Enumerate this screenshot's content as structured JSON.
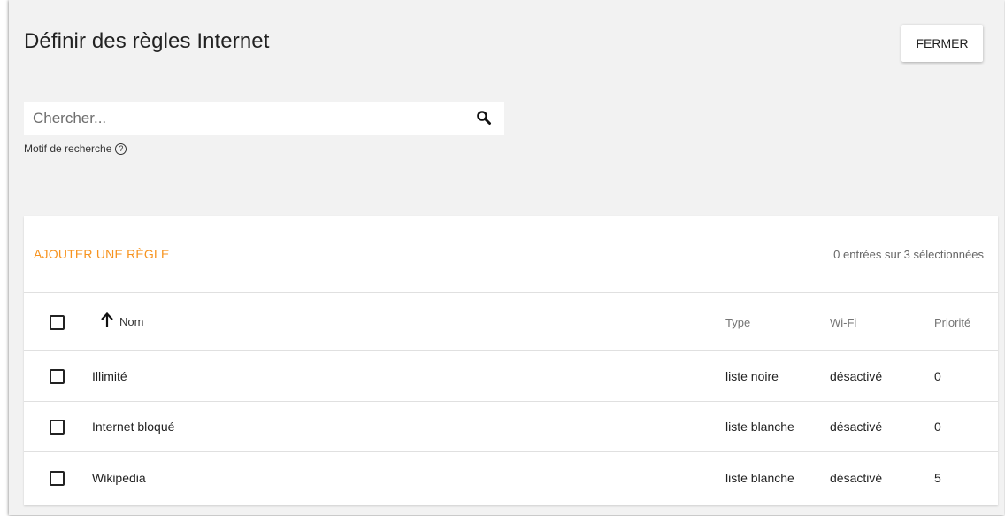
{
  "dialog": {
    "title": "Définir des règles Internet",
    "close_label": "FERMER"
  },
  "search": {
    "placeholder": "Chercher...",
    "value": "",
    "hint": "Motif de recherche",
    "search_icon": "search-icon",
    "help_icon": "help-circle-icon"
  },
  "table": {
    "add_rule_label": "AJOUTER UNE RÈGLE",
    "selection_text": "0 entrées sur 3 sélectionnées",
    "accent_color": "#f7931e",
    "headers": {
      "name": "Nom",
      "type": "Type",
      "wifi": "Wi-Fi",
      "priority": "Priorité",
      "sort_icon": "arrow-up-icon"
    },
    "rows": [
      {
        "name": "Illimité",
        "type": "liste noire",
        "wifi": "désactivé",
        "priority": "0"
      },
      {
        "name": "Internet bloqué",
        "type": "liste blanche",
        "wifi": "désactivé",
        "priority": "0"
      },
      {
        "name": "Wikipedia",
        "type": "liste blanche",
        "wifi": "désactivé",
        "priority": "5"
      }
    ]
  }
}
